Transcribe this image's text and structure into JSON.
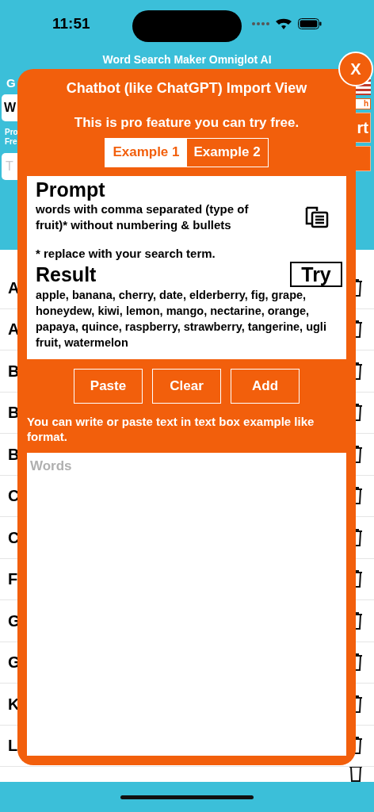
{
  "status_bar": {
    "time": "11:51"
  },
  "app_title": "Word Search Maker Omniglot AI",
  "background": {
    "label": "G",
    "field_value": "W",
    "note_lines": [
      "Pro",
      "Fre"
    ],
    "input_placeholder": "T",
    "small_button": "h",
    "large_button": "rt"
  },
  "list_rows": [
    {
      "initial": "A"
    },
    {
      "initial": "A"
    },
    {
      "initial": "B"
    },
    {
      "initial": "B"
    },
    {
      "initial": "B"
    },
    {
      "initial": "C"
    },
    {
      "initial": "C"
    },
    {
      "initial": "F"
    },
    {
      "initial": "G"
    },
    {
      "initial": "G"
    },
    {
      "initial": "K"
    },
    {
      "initial": "L"
    }
  ],
  "dialog": {
    "close": "X",
    "title": "Chatbot (like ChatGPT) Import View",
    "subtitle": "This is pro feature you can try free.",
    "tabs": [
      {
        "label": "Example 1",
        "selected": true
      },
      {
        "label": "Example 2",
        "selected": false
      }
    ],
    "prompt": {
      "heading": "Prompt",
      "text": "words with comma separated (type of fruit)* without numbering & bullets",
      "note": "* replace with your search term."
    },
    "result": {
      "heading": "Result",
      "try_button": "Try",
      "text": "apple, banana, cherry, date, elderberry, fig, grape, honeydew, kiwi, lemon, mango, nectarine, orange, papaya, quince, raspberry, strawberry, tangerine, ugli fruit, watermelon"
    },
    "buttons": [
      "Paste",
      "Clear",
      "Add"
    ],
    "hint": "You can write or paste text in text box example like format.",
    "words_placeholder": "Words"
  }
}
